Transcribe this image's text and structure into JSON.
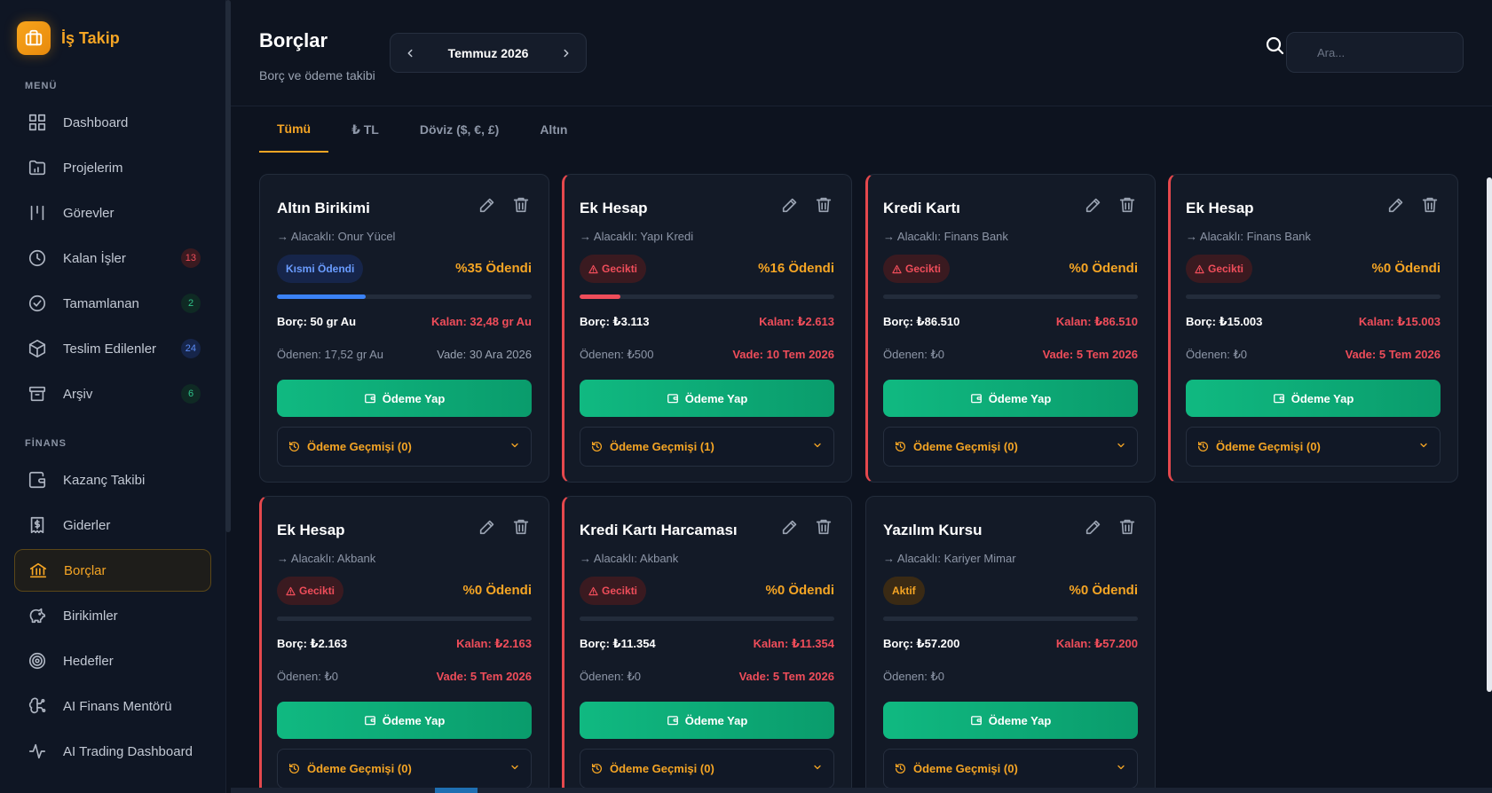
{
  "brand": {
    "name": "İş Takip"
  },
  "sidebar": {
    "menu_label": "MENÜ",
    "finance_label": "FİNANS",
    "menu_items": [
      {
        "label": "Dashboard",
        "icon": "dashboard-icon"
      },
      {
        "label": "Projelerim",
        "icon": "folder-icon"
      },
      {
        "label": "Görevler",
        "icon": "tasks-icon"
      },
      {
        "label": "Kalan İşler",
        "icon": "clock-icon",
        "badge": "13"
      },
      {
        "label": "Tamamlanan",
        "icon": "check-circle-icon",
        "badge": "2"
      },
      {
        "label": "Teslim Edilenler",
        "icon": "package-icon",
        "badge": "24"
      },
      {
        "label": "Arşiv",
        "icon": "archive-icon",
        "badge": "6"
      }
    ],
    "finance_items": [
      {
        "label": "Kazanç Takibi",
        "icon": "wallet-icon"
      },
      {
        "label": "Giderler",
        "icon": "receipt-icon"
      },
      {
        "label": "Borçlar",
        "icon": "bank-icon",
        "active": true
      },
      {
        "label": "Birikimler",
        "icon": "piggy-bank-icon"
      },
      {
        "label": "Hedefler",
        "icon": "target-icon"
      },
      {
        "label": "AI Finans Mentörü",
        "icon": "brain-icon"
      },
      {
        "label": "AI Trading Dashboard",
        "icon": "activity-icon"
      }
    ]
  },
  "header": {
    "title": "Borçlar",
    "subtitle": "Borç ve ödeme takibi",
    "month": "Temmuz 2026",
    "search_placeholder": "Ara..."
  },
  "tabs": [
    {
      "label": "Tümü",
      "active": true
    },
    {
      "label": "₺ TL"
    },
    {
      "label": "Döviz ($, €, £)"
    },
    {
      "label": "Altın"
    }
  ],
  "card_labels": {
    "pay": "Ödeme Yap"
  },
  "colors": {
    "accent": "#f5a524",
    "danger": "#ef4d5a",
    "success": "#10b981",
    "partial": "#3b82f6"
  },
  "debts": [
    {
      "title": "Altın Birikimi",
      "creditor": "→ Alacaklı: Onur Yücel",
      "status": "Kısmi Ödendi",
      "status_type": "partial",
      "paid_pct": "%35 Ödendi",
      "progress": 0.35,
      "debt": "Borç: 50 gr Au",
      "remaining": "Kalan: 32,48 gr Au",
      "paid": "Ödenen: 17,52 gr Au",
      "due": "Vade: 30 Ara 2026",
      "late": false,
      "history": "Ödeme Geçmişi (0)"
    },
    {
      "title": "Ek Hesap",
      "creditor": "→ Alacaklı: Yapı Kredi",
      "status": "Gecikti",
      "status_type": "late",
      "paid_pct": "%16 Ödendi",
      "progress": 0.16,
      "debt": "Borç: ₺3.113",
      "remaining": "Kalan: ₺2.613",
      "paid": "Ödenen: ₺500",
      "due": "Vade: 10 Tem 2026",
      "late": true,
      "history": "Ödeme Geçmişi (1)"
    },
    {
      "title": "Kredi Kartı",
      "creditor": "→ Alacaklı: Finans Bank",
      "status": "Gecikti",
      "status_type": "late",
      "paid_pct": "%0 Ödendi",
      "progress": 0,
      "debt": "Borç: ₺86.510",
      "remaining": "Kalan: ₺86.510",
      "paid": "Ödenen: ₺0",
      "due": "Vade: 5 Tem 2026",
      "late": true,
      "history": "Ödeme Geçmişi (0)"
    },
    {
      "title": "Ek Hesap",
      "creditor": "→ Alacaklı: Finans Bank",
      "status": "Gecikti",
      "status_type": "late",
      "paid_pct": "%0 Ödendi",
      "progress": 0,
      "debt": "Borç: ₺15.003",
      "remaining": "Kalan: ₺15.003",
      "paid": "Ödenen: ₺0",
      "due": "Vade: 5 Tem 2026",
      "late": true,
      "history": "Ödeme Geçmişi (0)"
    },
    {
      "title": "Ek Hesap",
      "creditor": "→ Alacaklı: Akbank",
      "status": "Gecikti",
      "status_type": "late",
      "paid_pct": "%0 Ödendi",
      "progress": 0,
      "debt": "Borç: ₺2.163",
      "remaining": "Kalan: ₺2.163",
      "paid": "Ödenen: ₺0",
      "due": "Vade: 5 Tem 2026",
      "late": true,
      "history": "Ödeme Geçmişi (0)"
    },
    {
      "title": "Kredi Kartı Harcaması",
      "creditor": "→ Alacaklı: Akbank",
      "status": "Gecikti",
      "status_type": "late",
      "paid_pct": "%0 Ödendi",
      "progress": 0,
      "debt": "Borç: ₺11.354",
      "remaining": "Kalan: ₺11.354",
      "paid": "Ödenen: ₺0",
      "due": "Vade: 5 Tem 2026",
      "late": true,
      "history": "Ödeme Geçmişi (0)"
    },
    {
      "title": "Yazılım Kursu",
      "creditor": "→ Alacaklı: Kariyer Mimar",
      "status": "Aktif",
      "status_type": "active",
      "paid_pct": "%0 Ödendi",
      "progress": 0,
      "debt": "Borç: ₺57.200",
      "remaining": "Kalan: ₺57.200",
      "paid": "Ödenen: ₺0",
      "due": "",
      "late": false,
      "history": "Ödeme Geçmişi (0)"
    }
  ]
}
